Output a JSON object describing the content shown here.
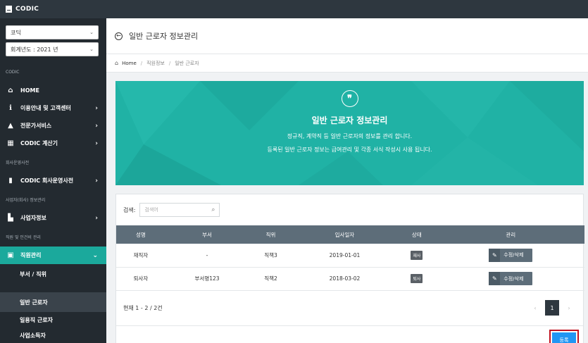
{
  "topbar": {
    "brand": "CODIC"
  },
  "sidebar": {
    "font_select": "코딕",
    "year_select": "회계년도 : 2021 년",
    "sections": [
      "CODIC",
      "회사운영사전",
      "사업자(회사) 정보관리",
      "직원 및 인건비 관리"
    ],
    "items": [
      {
        "label": "HOME",
        "icon": "home-icon"
      },
      {
        "label": "이용안내 및 고객센터",
        "icon": "info-icon"
      },
      {
        "label": "전문가서비스",
        "icon": "graduation-cap-icon"
      },
      {
        "label": "CODIC 계산기",
        "icon": "calculator-icon"
      },
      {
        "label": "CODIC 회사운영사전",
        "icon": "book-icon"
      },
      {
        "label": "사업자정보",
        "icon": "building-icon"
      },
      {
        "label": "직원관리",
        "icon": "user-card-icon"
      }
    ],
    "subitems": [
      "부서 / 직위",
      "일반 근로자",
      "일용직 근로자",
      "사업소득자"
    ],
    "arrow": "›",
    "open_arrow": "⌄"
  },
  "header": {
    "title": "일반 근로자 정보관리"
  },
  "breadcrumb": {
    "home": "Home",
    "sep": "/",
    "section": "직원정보",
    "page": "일반 근로자"
  },
  "hero": {
    "title": "일반 근로자 정보관리",
    "line1": "정규직, 계약직 등 일반 근로자의 정보를 관리 합니다.",
    "line2": "등록된 일반 근로자 정보는 급여관리 및 각종 서식 작성시 사용 됩니다."
  },
  "search": {
    "label": "검색:",
    "placeholder": "검색어"
  },
  "table": {
    "headers": [
      "성명",
      "부서",
      "직위",
      "입사일자",
      "상태",
      "관리"
    ],
    "rows": [
      {
        "name": "재직자",
        "dept": "-",
        "position": "직책3",
        "date": "2019-01-01",
        "status": "재사",
        "action": "수정/삭제"
      },
      {
        "name": "퇴사자",
        "dept": "부서명123",
        "position": "직책2",
        "date": "2018-03-02",
        "status": "퇴사",
        "action": "수정/삭제"
      }
    ]
  },
  "pagination": {
    "summary": "현재 1 - 2 / 2건",
    "prev": "‹",
    "current": "1",
    "next": "›"
  },
  "register_label": "등록",
  "colors": {
    "accent": "#20b2a5",
    "sidebar": "#232a30",
    "header_row": "#5d6d79",
    "register": "#2196f3",
    "highlight": "#c0111f"
  }
}
